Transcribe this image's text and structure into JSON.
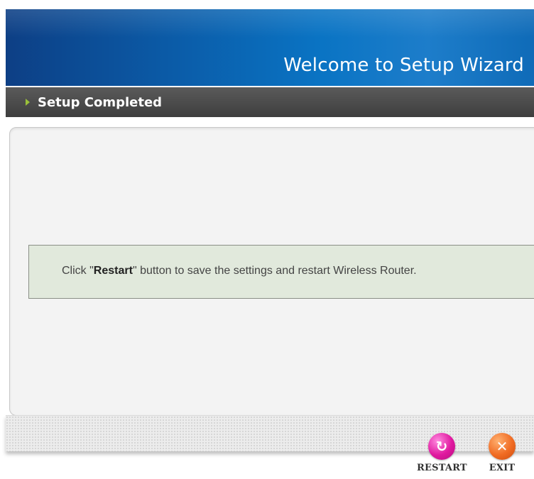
{
  "header": {
    "title": "Welcome to Setup Wizard"
  },
  "section": {
    "title": "Setup Completed"
  },
  "message": {
    "prefix": "Click \"",
    "bold": "Restart",
    "suffix": "\" button to save the settings and restart Wireless Router."
  },
  "buttons": {
    "restart": {
      "label": "RESTART",
      "icon": "refresh-icon"
    },
    "exit": {
      "label": "EXIT",
      "icon": "close-icon"
    }
  },
  "colors": {
    "header_blue": "#0a74c4",
    "titlebar_gray": "#3e3e3e",
    "message_bg": "#e1e9dc",
    "restart_pink": "#e0189f",
    "exit_orange": "#f06b23"
  }
}
